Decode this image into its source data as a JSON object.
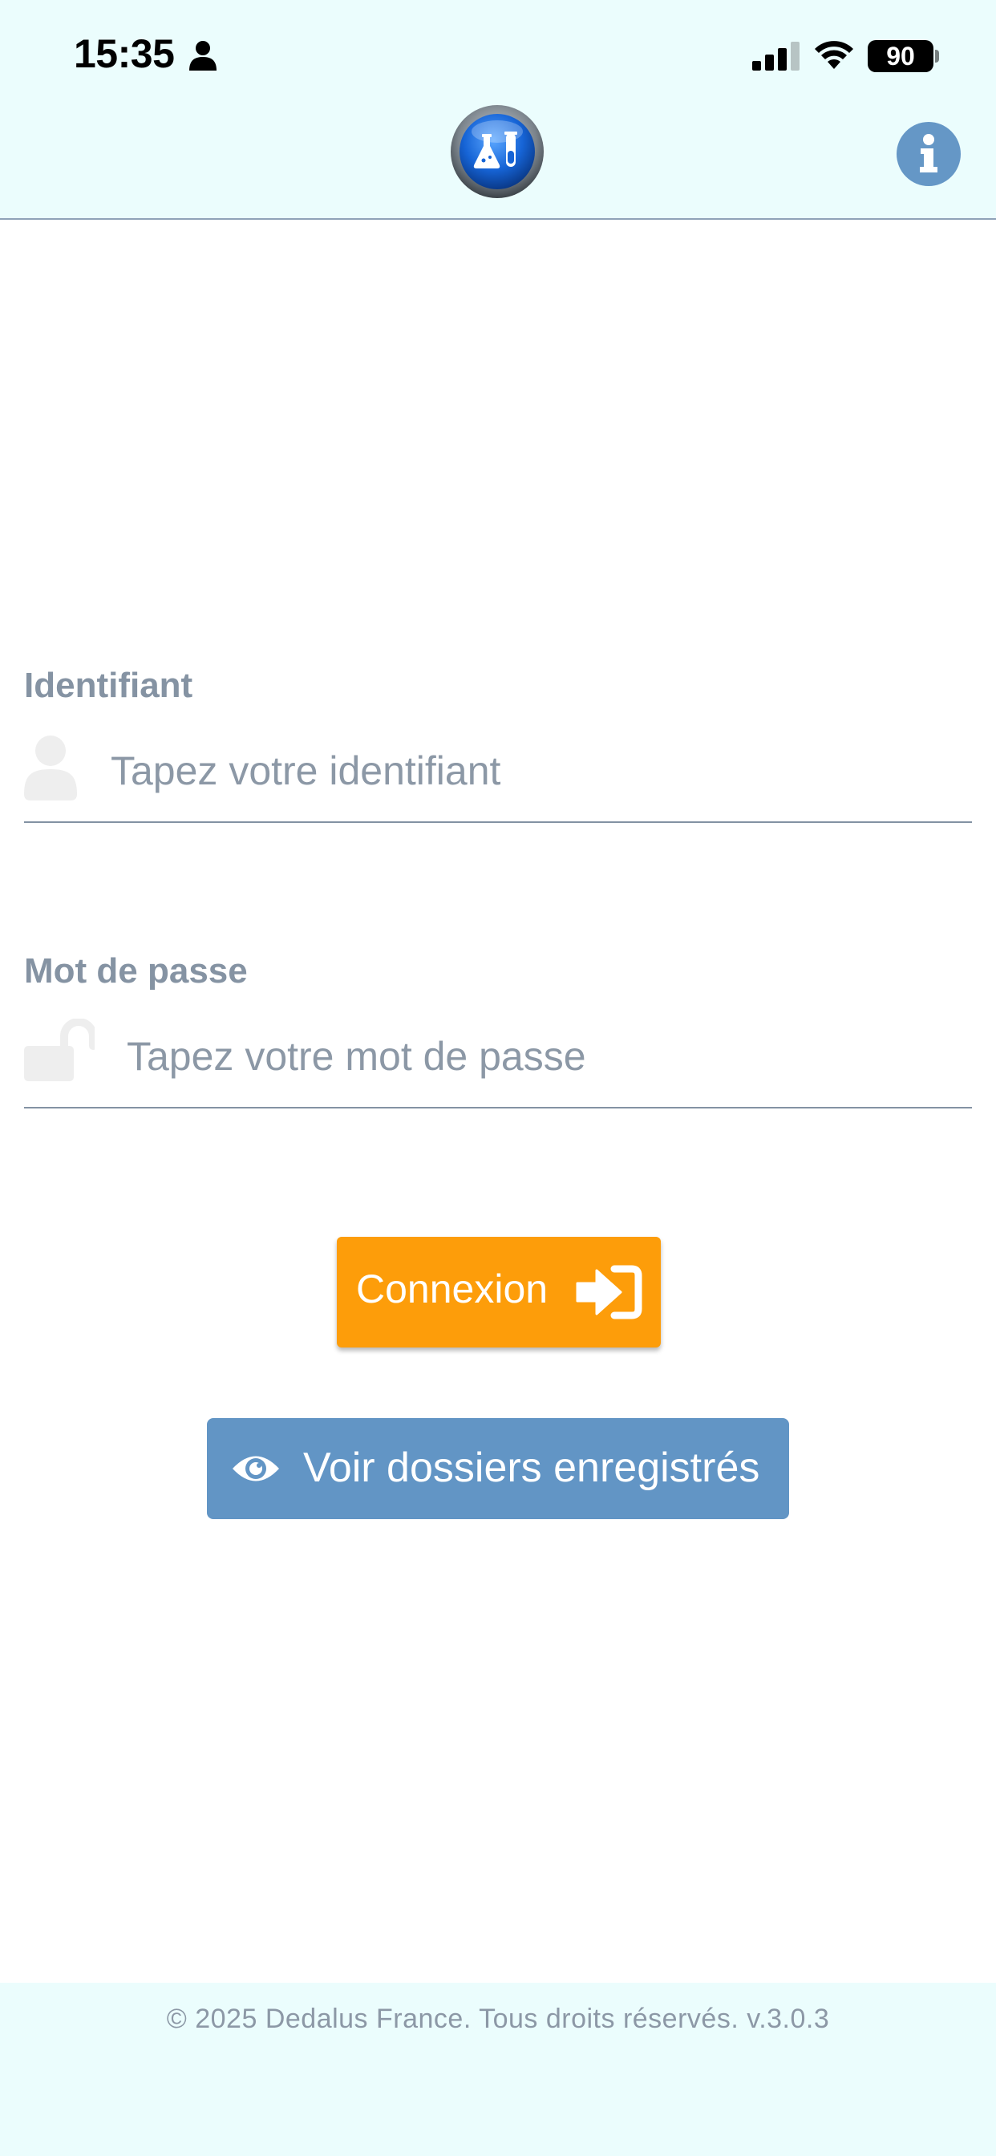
{
  "status_bar": {
    "time": "15:35",
    "battery": "90",
    "icons": [
      "person-icon",
      "signal-icon",
      "wifi-icon",
      "battery-icon"
    ]
  },
  "header": {
    "logo_icon": "lab-flask-logo-icon",
    "info_icon": "info-icon"
  },
  "form": {
    "username": {
      "label": "Identifiant",
      "placeholder": "Tapez votre identifiant",
      "value": "",
      "icon": "user-icon"
    },
    "password": {
      "label": "Mot de passe",
      "placeholder": "Tapez votre mot de passe",
      "value": "",
      "icon": "unlock-icon"
    }
  },
  "actions": {
    "connect_label": "Connexion",
    "connect_icon": "sign-in-icon",
    "saved_label": "Voir dossiers enregistrés",
    "saved_icon": "eye-icon"
  },
  "footer": {
    "copyright": "© 2025 Dedalus France. Tous droits réservés. v.3.0.3"
  },
  "colors": {
    "header_bg": "#ebfdfd",
    "primary_orange": "#fd9d0a",
    "secondary_blue": "#6295c5",
    "label_gray": "#8593a3"
  }
}
